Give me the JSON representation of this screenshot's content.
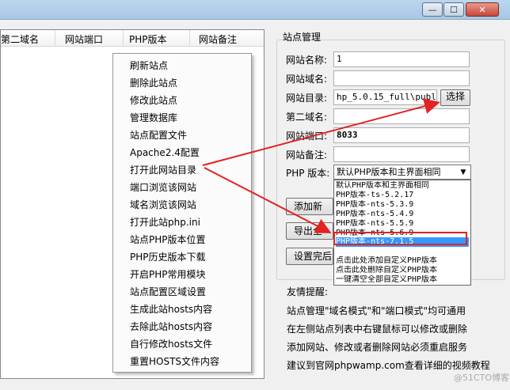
{
  "window": {
    "minimize": "—",
    "maximize": "☐",
    "close": "✕"
  },
  "list": {
    "columns": [
      "第二域名",
      "网站端口",
      "PHP版本",
      "网站备注"
    ]
  },
  "context_menu": {
    "items": [
      "刷新站点",
      "删除此站点",
      "修改此站点",
      "管理数据库",
      "站点配置文件",
      "Apache2.4配置",
      "打开此网站目录",
      "端口浏览该网站",
      "域名浏览该网站",
      "打开此站php.ini",
      "站点PHP版本位置",
      "PHP历史版本下载",
      "开启PHP常用模块",
      "站点配置区域设置",
      "生成此站hosts内容",
      "去除此站hosts内容",
      "自行修改hosts文件",
      "重置HOSTS文件内容"
    ]
  },
  "site": {
    "group_label": "站点管理",
    "name_label": "网站名称:",
    "name_value": "1",
    "domain_label": "网站域名:",
    "domain_value": "",
    "dir_label": "网站目录:",
    "dir_value": "hp_5.0.15_full\\public",
    "browse": "选择",
    "second_domain_label": "第二域名:",
    "second_domain_value": "",
    "port_label": "网站端口:",
    "port_value": "8033",
    "remark_label": "网站备注:",
    "remark_value": "",
    "php_label": "PHP 版本:",
    "php_selected": "默认PHP版本和主界面相同",
    "buttons": [
      "添加新",
      "导出全",
      "设置完后"
    ]
  },
  "dropdown": {
    "options": [
      "默认PHP版本和主界面相同",
      "PHP版本-ts-5.2.17",
      "PHP版本-nts-5.3.9",
      "PHP版本-nts-5.4.9",
      "PHP版本-nts-5.5.9",
      "PHP版本-nts-5.6.9",
      "PHP版本-nts-7.1.5",
      "",
      "点击此处添加自定义PHP版本",
      "点击此处删除自定义PHP版本",
      "一键清空全部自定义PHP版本"
    ],
    "selected_index": 6
  },
  "tips": {
    "title": "友情提醒:",
    "lines": [
      "站点管理\"域名模式\"和\"端口模式\"均可通用",
      "在左侧站点列表中右键鼠标可以修改或删除",
      "添加网站、修改或者删除网站必须重启服务",
      "建议到官网phpwamp.com查看详细的视频教程"
    ]
  },
  "watermark": "@51CTO博客",
  "colors": {
    "highlight": "#3399ff",
    "annotation": "#e32222"
  }
}
